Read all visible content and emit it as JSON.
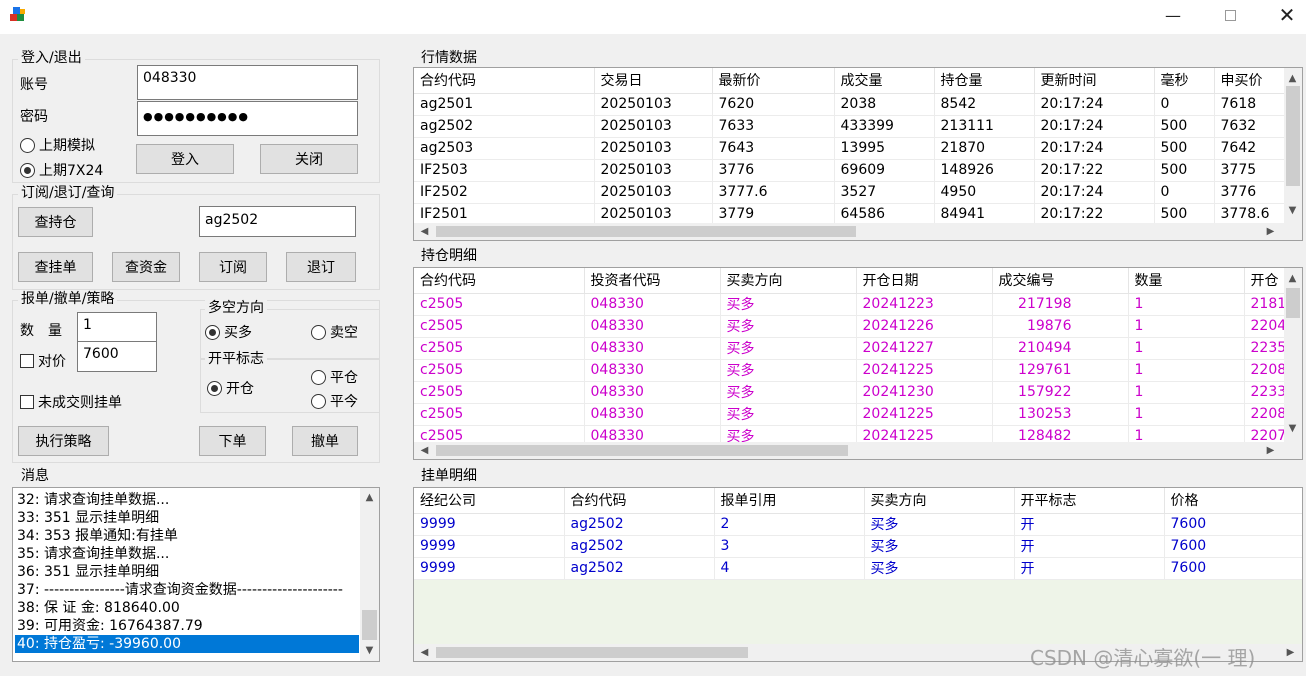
{
  "login": {
    "group_title": "登入/退出",
    "account_label": "账号",
    "account_value": "048330",
    "password_label": "密码",
    "password_value": "●●●●●●●●●●",
    "radio_sim": "上期模拟",
    "radio_7x24": "上期7X24",
    "login_button": "登入",
    "close_button": "关闭"
  },
  "subscribe": {
    "group_title": "订阅/退订/查询",
    "query_position_button": "查持仓",
    "symbol_value": "ag2502",
    "query_orders_button": "查挂单",
    "query_funds_button": "查资金",
    "subscribe_button": "订阅",
    "unsubscribe_button": "退订"
  },
  "order": {
    "group_title": "报单/撤单/策略",
    "quantity_label": "数　量",
    "quantity_value": "1",
    "counter_price_label": "对价",
    "price_value": "7600",
    "cancel_unfilled_label": "未成交则挂单",
    "direction_title": "多空方向",
    "buy_label": "买多",
    "sell_label": "卖空",
    "offset_title": "开平标志",
    "open_label": "开仓",
    "close_label": "平仓",
    "close_today_label": "平今",
    "run_strategy_button": "执行策略",
    "place_order_button": "下单",
    "cancel_order_button": "撤单"
  },
  "messages": {
    "group_title": "消息",
    "lines": [
      "32: 请求查询挂单数据...",
      "33: 351 显示挂单明细",
      "34: 353 报单通知:有挂单",
      "35: 请求查询挂单数据...",
      "36: 351 显示挂单明细",
      "37: ----------------请求查询资金数据---------------------",
      "38: 保 证  金: 818640.00",
      "39: 可用资金: 16764387.79",
      "40: 持仓盈亏: -39960.00"
    ]
  },
  "market": {
    "group_title": "行情数据",
    "columns": [
      "合约代码",
      "交易日",
      "最新价",
      "成交量",
      "持仓量",
      "更新时间",
      "毫秒",
      "申买价"
    ],
    "rows": [
      [
        "ag2501",
        "20250103",
        "7620",
        "2038",
        "8542",
        "20:17:24",
        "0",
        "7618"
      ],
      [
        "ag2502",
        "20250103",
        "7633",
        "433399",
        "213111",
        "20:17:24",
        "500",
        "7632"
      ],
      [
        "ag2503",
        "20250103",
        "7643",
        "13995",
        "21870",
        "20:17:24",
        "500",
        "7642"
      ],
      [
        "IF2503",
        "20250103",
        "3776",
        "69609",
        "148926",
        "20:17:22",
        "500",
        "3775"
      ],
      [
        "IF2502",
        "20250103",
        "3777.6",
        "3527",
        "4950",
        "20:17:24",
        "0",
        "3776"
      ],
      [
        "IF2501",
        "20250103",
        "3779",
        "64586",
        "84941",
        "20:17:22",
        "500",
        "3778.6"
      ]
    ]
  },
  "positions": {
    "group_title": "持仓明细",
    "columns": [
      "合约代码",
      "投资者代码",
      "买卖方向",
      "开仓日期",
      "成交编号",
      "数量",
      "开仓"
    ],
    "rows": [
      [
        "c2505",
        "048330",
        "买多",
        "20241223",
        "217198",
        "1",
        "2181"
      ],
      [
        "c2505",
        "048330",
        "买多",
        "20241226",
        "19876",
        "1",
        "2204"
      ],
      [
        "c2505",
        "048330",
        "买多",
        "20241227",
        "210494",
        "1",
        "2235"
      ],
      [
        "c2505",
        "048330",
        "买多",
        "20241225",
        "129761",
        "1",
        "2208"
      ],
      [
        "c2505",
        "048330",
        "买多",
        "20241230",
        "157922",
        "1",
        "2233"
      ],
      [
        "c2505",
        "048330",
        "买多",
        "20241225",
        "130253",
        "1",
        "2208"
      ],
      [
        "c2505",
        "048330",
        "买多",
        "20241225",
        "128482",
        "1",
        "2207"
      ]
    ],
    "text_color": "#cc00cc"
  },
  "pending": {
    "group_title": "挂单明细",
    "columns": [
      "经纪公司",
      "合约代码",
      "报单引用",
      "买卖方向",
      "开平标志",
      "价格"
    ],
    "rows": [
      [
        "9999",
        "ag2502",
        "2",
        "买多",
        "开",
        "7600"
      ],
      [
        "9999",
        "ag2502",
        "3",
        "买多",
        "开",
        "7600"
      ],
      [
        "9999",
        "ag2502",
        "4",
        "买多",
        "开",
        "7600"
      ]
    ],
    "text_color": "#0000cc"
  },
  "watermark": "CSDN @清心寡欲(一 理)",
  "icons": {
    "app": "app-cubes-icon",
    "minimize": "minimize-icon",
    "maximize": "maximize-icon",
    "close": "close-icon"
  }
}
